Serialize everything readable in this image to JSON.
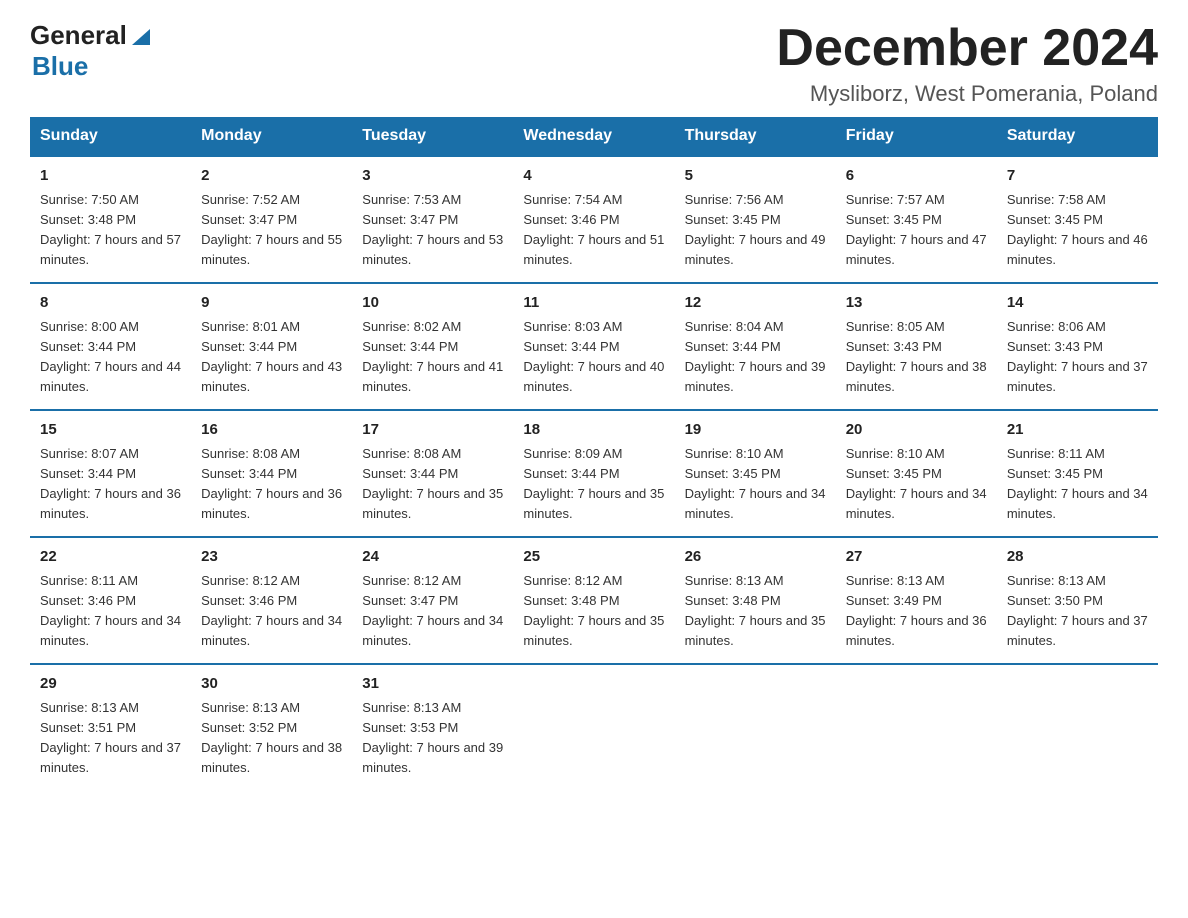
{
  "logo": {
    "text_general": "General",
    "text_blue": "Blue"
  },
  "title": "December 2024",
  "location": "Mysliborz, West Pomerania, Poland",
  "weekdays": [
    "Sunday",
    "Monday",
    "Tuesday",
    "Wednesday",
    "Thursday",
    "Friday",
    "Saturday"
  ],
  "weeks": [
    [
      {
        "day": "1",
        "sunrise": "Sunrise: 7:50 AM",
        "sunset": "Sunset: 3:48 PM",
        "daylight": "Daylight: 7 hours and 57 minutes."
      },
      {
        "day": "2",
        "sunrise": "Sunrise: 7:52 AM",
        "sunset": "Sunset: 3:47 PM",
        "daylight": "Daylight: 7 hours and 55 minutes."
      },
      {
        "day": "3",
        "sunrise": "Sunrise: 7:53 AM",
        "sunset": "Sunset: 3:47 PM",
        "daylight": "Daylight: 7 hours and 53 minutes."
      },
      {
        "day": "4",
        "sunrise": "Sunrise: 7:54 AM",
        "sunset": "Sunset: 3:46 PM",
        "daylight": "Daylight: 7 hours and 51 minutes."
      },
      {
        "day": "5",
        "sunrise": "Sunrise: 7:56 AM",
        "sunset": "Sunset: 3:45 PM",
        "daylight": "Daylight: 7 hours and 49 minutes."
      },
      {
        "day": "6",
        "sunrise": "Sunrise: 7:57 AM",
        "sunset": "Sunset: 3:45 PM",
        "daylight": "Daylight: 7 hours and 47 minutes."
      },
      {
        "day": "7",
        "sunrise": "Sunrise: 7:58 AM",
        "sunset": "Sunset: 3:45 PM",
        "daylight": "Daylight: 7 hours and 46 minutes."
      }
    ],
    [
      {
        "day": "8",
        "sunrise": "Sunrise: 8:00 AM",
        "sunset": "Sunset: 3:44 PM",
        "daylight": "Daylight: 7 hours and 44 minutes."
      },
      {
        "day": "9",
        "sunrise": "Sunrise: 8:01 AM",
        "sunset": "Sunset: 3:44 PM",
        "daylight": "Daylight: 7 hours and 43 minutes."
      },
      {
        "day": "10",
        "sunrise": "Sunrise: 8:02 AM",
        "sunset": "Sunset: 3:44 PM",
        "daylight": "Daylight: 7 hours and 41 minutes."
      },
      {
        "day": "11",
        "sunrise": "Sunrise: 8:03 AM",
        "sunset": "Sunset: 3:44 PM",
        "daylight": "Daylight: 7 hours and 40 minutes."
      },
      {
        "day": "12",
        "sunrise": "Sunrise: 8:04 AM",
        "sunset": "Sunset: 3:44 PM",
        "daylight": "Daylight: 7 hours and 39 minutes."
      },
      {
        "day": "13",
        "sunrise": "Sunrise: 8:05 AM",
        "sunset": "Sunset: 3:43 PM",
        "daylight": "Daylight: 7 hours and 38 minutes."
      },
      {
        "day": "14",
        "sunrise": "Sunrise: 8:06 AM",
        "sunset": "Sunset: 3:43 PM",
        "daylight": "Daylight: 7 hours and 37 minutes."
      }
    ],
    [
      {
        "day": "15",
        "sunrise": "Sunrise: 8:07 AM",
        "sunset": "Sunset: 3:44 PM",
        "daylight": "Daylight: 7 hours and 36 minutes."
      },
      {
        "day": "16",
        "sunrise": "Sunrise: 8:08 AM",
        "sunset": "Sunset: 3:44 PM",
        "daylight": "Daylight: 7 hours and 36 minutes."
      },
      {
        "day": "17",
        "sunrise": "Sunrise: 8:08 AM",
        "sunset": "Sunset: 3:44 PM",
        "daylight": "Daylight: 7 hours and 35 minutes."
      },
      {
        "day": "18",
        "sunrise": "Sunrise: 8:09 AM",
        "sunset": "Sunset: 3:44 PM",
        "daylight": "Daylight: 7 hours and 35 minutes."
      },
      {
        "day": "19",
        "sunrise": "Sunrise: 8:10 AM",
        "sunset": "Sunset: 3:45 PM",
        "daylight": "Daylight: 7 hours and 34 minutes."
      },
      {
        "day": "20",
        "sunrise": "Sunrise: 8:10 AM",
        "sunset": "Sunset: 3:45 PM",
        "daylight": "Daylight: 7 hours and 34 minutes."
      },
      {
        "day": "21",
        "sunrise": "Sunrise: 8:11 AM",
        "sunset": "Sunset: 3:45 PM",
        "daylight": "Daylight: 7 hours and 34 minutes."
      }
    ],
    [
      {
        "day": "22",
        "sunrise": "Sunrise: 8:11 AM",
        "sunset": "Sunset: 3:46 PM",
        "daylight": "Daylight: 7 hours and 34 minutes."
      },
      {
        "day": "23",
        "sunrise": "Sunrise: 8:12 AM",
        "sunset": "Sunset: 3:46 PM",
        "daylight": "Daylight: 7 hours and 34 minutes."
      },
      {
        "day": "24",
        "sunrise": "Sunrise: 8:12 AM",
        "sunset": "Sunset: 3:47 PM",
        "daylight": "Daylight: 7 hours and 34 minutes."
      },
      {
        "day": "25",
        "sunrise": "Sunrise: 8:12 AM",
        "sunset": "Sunset: 3:48 PM",
        "daylight": "Daylight: 7 hours and 35 minutes."
      },
      {
        "day": "26",
        "sunrise": "Sunrise: 8:13 AM",
        "sunset": "Sunset: 3:48 PM",
        "daylight": "Daylight: 7 hours and 35 minutes."
      },
      {
        "day": "27",
        "sunrise": "Sunrise: 8:13 AM",
        "sunset": "Sunset: 3:49 PM",
        "daylight": "Daylight: 7 hours and 36 minutes."
      },
      {
        "day": "28",
        "sunrise": "Sunrise: 8:13 AM",
        "sunset": "Sunset: 3:50 PM",
        "daylight": "Daylight: 7 hours and 37 minutes."
      }
    ],
    [
      {
        "day": "29",
        "sunrise": "Sunrise: 8:13 AM",
        "sunset": "Sunset: 3:51 PM",
        "daylight": "Daylight: 7 hours and 37 minutes."
      },
      {
        "day": "30",
        "sunrise": "Sunrise: 8:13 AM",
        "sunset": "Sunset: 3:52 PM",
        "daylight": "Daylight: 7 hours and 38 minutes."
      },
      {
        "day": "31",
        "sunrise": "Sunrise: 8:13 AM",
        "sunset": "Sunset: 3:53 PM",
        "daylight": "Daylight: 7 hours and 39 minutes."
      },
      null,
      null,
      null,
      null
    ]
  ]
}
